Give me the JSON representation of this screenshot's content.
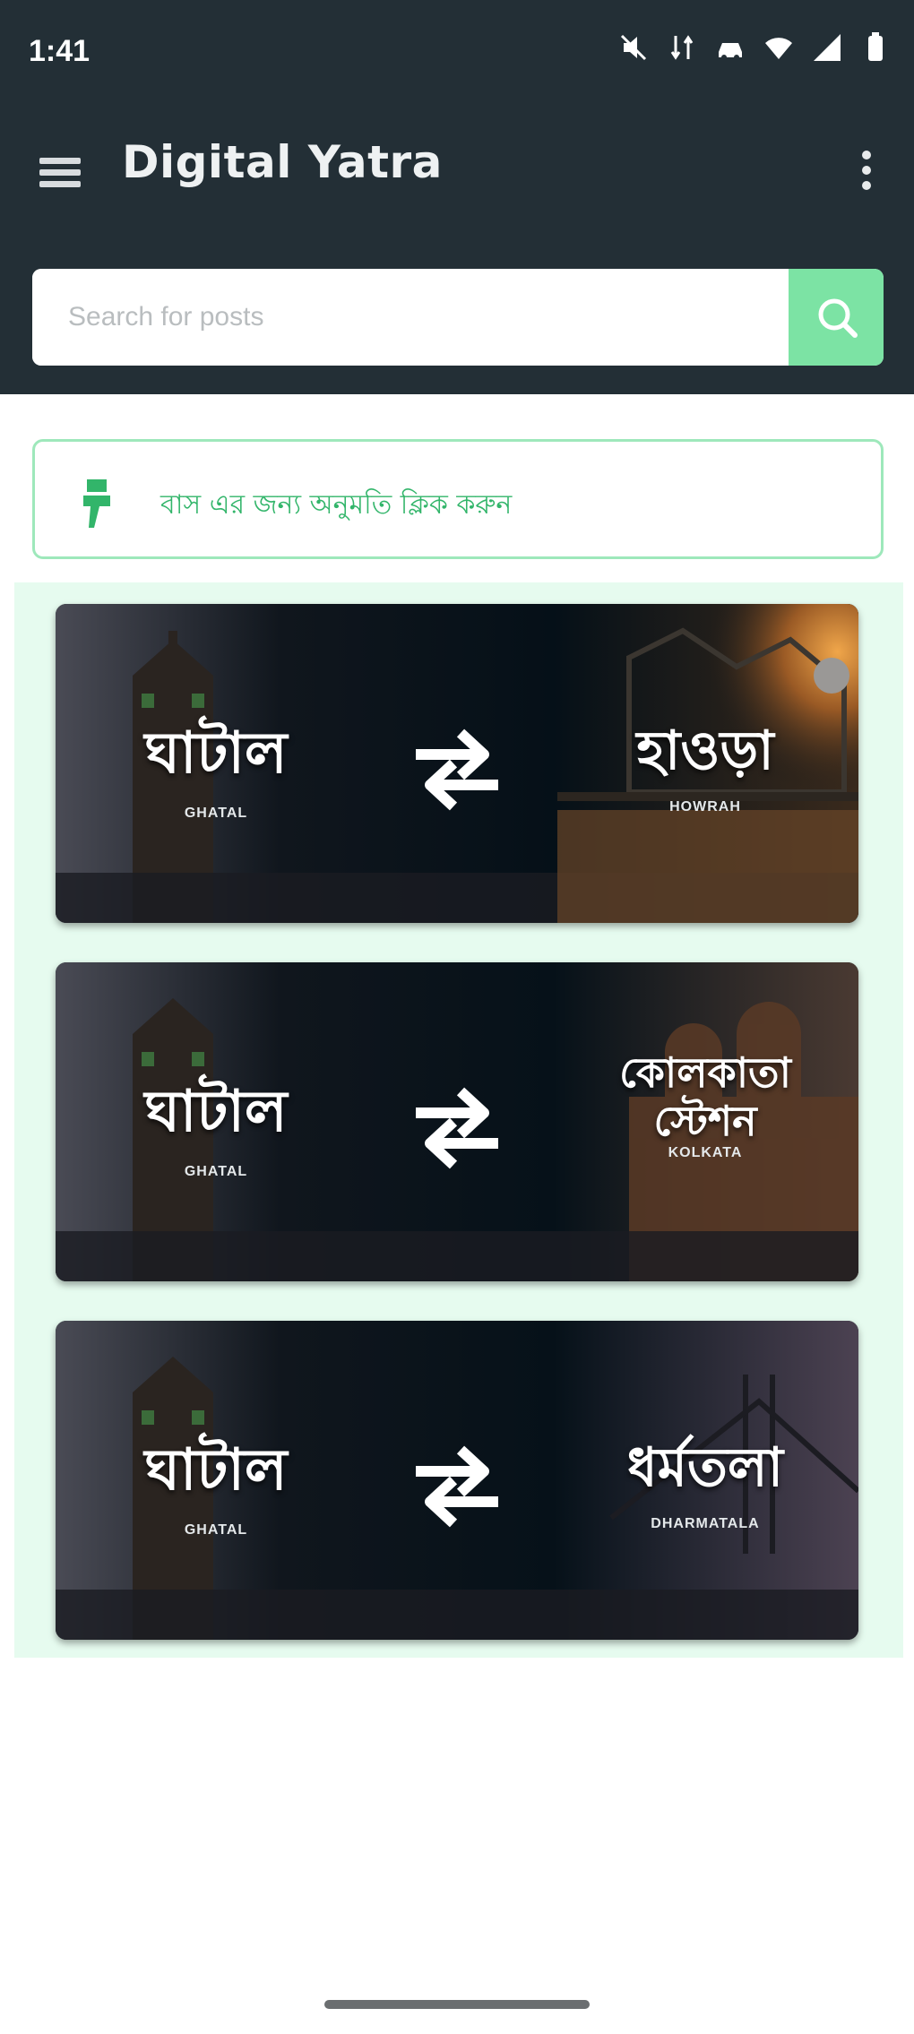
{
  "status_bar": {
    "time": "1:41",
    "icons": [
      "mute-icon",
      "data-icon",
      "car-icon",
      "wifi-icon",
      "signal-icon",
      "battery-icon"
    ]
  },
  "app_bar": {
    "title": "Digital Yatra",
    "menu_icon": "hamburger-icon",
    "more_icon": "more-vertical-icon"
  },
  "search": {
    "placeholder": "Search for posts",
    "button_icon": "search-icon"
  },
  "notice": {
    "text": "বাস এর জন্য অনুমতি ক্লিক করুন",
    "icon": "thumbs-up-icon"
  },
  "routes": [
    {
      "from": {
        "bn": "ঘাটাল",
        "en": "GHATAL"
      },
      "to": {
        "bn": "হাওড়া",
        "en": "HOWRAH"
      }
    },
    {
      "from": {
        "bn": "ঘাটাল",
        "en": "GHATAL"
      },
      "to": {
        "bn": "কোলকাতা স্টেশন",
        "bn_line1": "কোলকাতা",
        "bn_line2": "স্টেশন",
        "en": "KOLKATA"
      }
    },
    {
      "from": {
        "bn": "ঘাটাল",
        "en": "GHATAL"
      },
      "to": {
        "bn": "ধর্মতলা",
        "en": "DHARMATALA"
      }
    }
  ],
  "colors": {
    "header": "#232f36",
    "accent": "#7ce3a4",
    "accent_text": "#32b56a",
    "panel_bg": "#e6fbef"
  }
}
